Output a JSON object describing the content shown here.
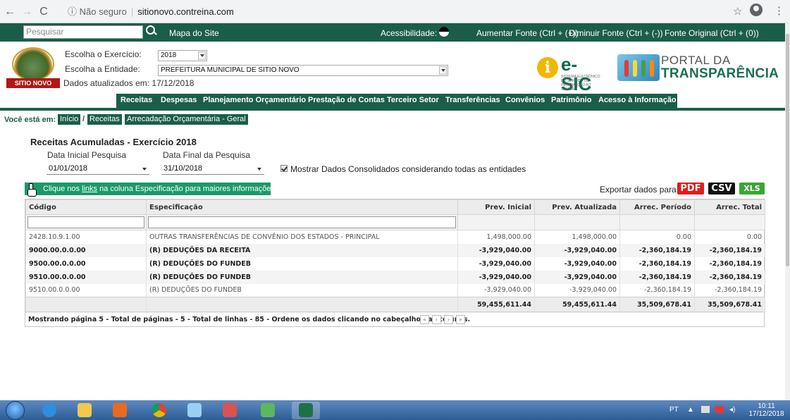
{
  "browser": {
    "back": "←",
    "forward": "→",
    "reload": "C",
    "insecure_label": "ⓘ Não seguro",
    "url": "sitionovo.contreina.com",
    "star": "☆",
    "menu": "⋮"
  },
  "topstrip": {
    "search_placeholder": "Pesquisar",
    "sitemap": "Mapa do Site",
    "accessibility": "Acessibilidade:",
    "increase_font": "Aumentar Fonte (Ctrl + (+))",
    "decrease_font": "Diminuir Fonte (Ctrl + (-))",
    "original_font": "Fonte Original (Ctrl + (0))"
  },
  "header": {
    "logo_text": "SITIO NOVO",
    "exercise_label": "Escolha o Exercício:",
    "exercise_value": "2018",
    "entity_label": "Escolha a Entidade:",
    "entity_value": "PREFEITURA MUNICIPAL DE SITIO NOVO",
    "updated": "Dados atualizados em: 17/12/2018",
    "esic": "e-SIC",
    "esic_small": "SISTEMA ELETRÔNICO DO SERVIÇO DE INFORMAÇÃO AO CIDADÃO",
    "portal1": "PORTAL DA",
    "portal2": "TRANSPARÊNCIA"
  },
  "nav": [
    "Receitas",
    "Despesas",
    "Planejamento Orçamentário",
    "Prestação de Contas",
    "Terceiro Setor",
    "Transferências",
    "Convênios",
    "Patrimônio",
    "Acesso à Informação"
  ],
  "breadcrumb": {
    "label": "Você está em:",
    "items": [
      "Início",
      "Receitas",
      "Arrecadação Orçamentária - Geral"
    ],
    "sep": "/"
  },
  "filters": {
    "title": "Receitas Acumuladas - Exercício 2018",
    "start_label": "Data Inicial Pesquisa",
    "start_value": "01/01/2018",
    "end_label": "Data Final da Pesquisa",
    "end_value": "31/10/2018",
    "consolidated": "Mostrar Dados Consolidados considerando todas as entidades"
  },
  "info": {
    "pre": "Clique nos ",
    "link": "links",
    "post": " na coluna Especificação para maiores informações."
  },
  "export": {
    "label": "Exportar dados para:",
    "pdf": "PDF",
    "csv": "CSV",
    "xls": "XLS"
  },
  "table": {
    "headers": [
      "Código",
      "Especificação",
      "Prev. Inicial",
      "Prev. Atualizada",
      "Arrec. Período",
      "Arrec. Total"
    ],
    "rows": [
      [
        "2428.10.9.1.00",
        "OUTRAS TRANSFERÊNCIAS DE CONVÊNIO DOS ESTADOS - PRINCIPAL",
        "1,498,000.00",
        "1,498,000.00",
        "0.00",
        "0.00"
      ],
      [
        "9000.00.0.0.00",
        "(R) DEDUÇÕES DA RECEITA",
        "-3,929,040.00",
        "-3,929,040.00",
        "-2,360,184.19",
        "-2,360,184.19"
      ],
      [
        "9500.00.0.0.00",
        "(R) DEDUÇÕES DO FUNDEB",
        "-3,929,040.00",
        "-3,929,040.00",
        "-2,360,184.19",
        "-2,360,184.19"
      ],
      [
        "9510.00.0.0.00",
        "(R) DEDUÇÕES DO FUNDEB",
        "-3,929,040.00",
        "-3,929,040.00",
        "-2,360,184.19",
        "-2,360,184.19"
      ],
      [
        "9510.00.0.0.00",
        "(R) DEDUÇÕES DO FUNDEB",
        "-3,929,040.00",
        "-3,929,040.00",
        "-2,360,184.19",
        "-2,360,184.19"
      ]
    ],
    "totals": [
      "59,455,611.44",
      "59,455,611.44",
      "35,509,678.41",
      "35,509,678.41"
    ],
    "pager_text": "Mostrando página 5 - Total de páginas - 5 - Total de linhas - 85 - Ordene os dados clicando no cabeçalho das colunas.",
    "pager_buttons": [
      "«",
      "‹",
      "›",
      "»"
    ]
  },
  "taskbar": {
    "lang": "PT",
    "time": "10:11",
    "date": "17/12/2018"
  },
  "colors": {
    "primary_green": "#1a5e4a",
    "info_green": "#1a9a6a",
    "pdf_red": "#e31b1b",
    "csv_black": "#111111",
    "xls_green": "#3aa635"
  }
}
